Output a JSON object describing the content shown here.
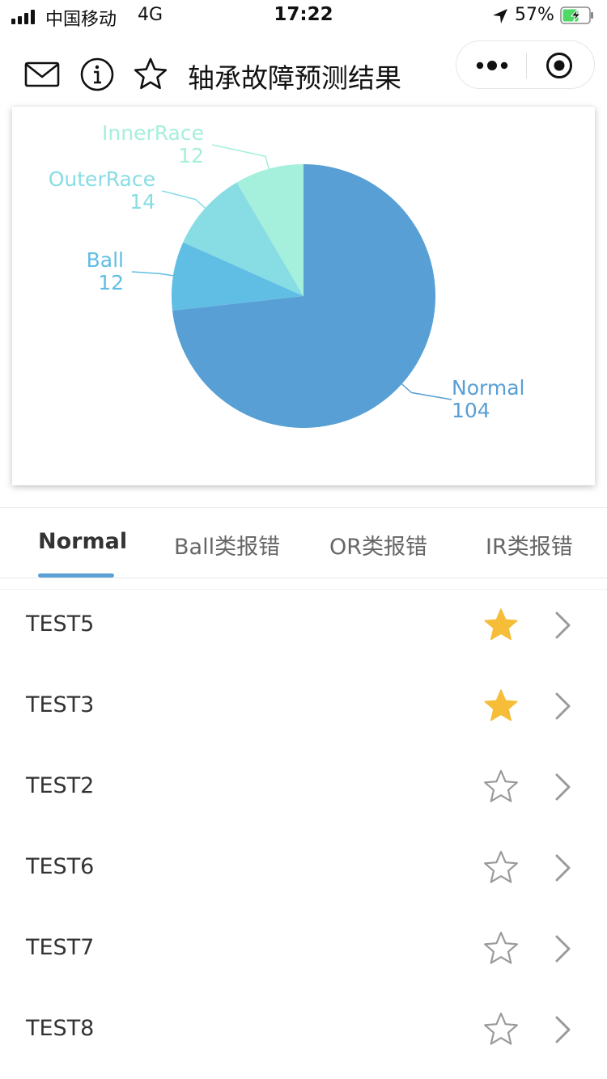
{
  "status_bar": {
    "carrier": "中国移动",
    "network": "4G",
    "time": "17:22",
    "battery": "57%",
    "icons": [
      "signal-icon",
      "location-arrow-icon",
      "battery-charging-icon"
    ]
  },
  "nav": {
    "title": "轴承故障预测结果",
    "icons": [
      "mail-icon",
      "info-icon",
      "star-outline-icon",
      "more-dots-icon",
      "target-icon"
    ]
  },
  "chart_data": {
    "type": "pie",
    "slices": [
      {
        "label": "Normal",
        "value": 104,
        "color": "#579fd5"
      },
      {
        "label": "Ball",
        "value": 12,
        "color": "#60bee4"
      },
      {
        "label": "OuterRace",
        "value": 14,
        "color": "#87dde3"
      },
      {
        "label": "InnerRace",
        "value": 12,
        "color": "#a5efdd"
      }
    ]
  },
  "tabs": [
    {
      "label": "Normal",
      "active": true
    },
    {
      "label": "Ball类报错",
      "active": false
    },
    {
      "label": "OR类报错",
      "active": false
    },
    {
      "label": "IR类报错",
      "active": false
    }
  ],
  "list": [
    {
      "name": "TEST5",
      "starred": true
    },
    {
      "name": "TEST3",
      "starred": true
    },
    {
      "name": "TEST2",
      "starred": false
    },
    {
      "name": "TEST6",
      "starred": false
    },
    {
      "name": "TEST7",
      "starred": false
    },
    {
      "name": "TEST8",
      "starred": false
    }
  ],
  "colors": {
    "accent": "#5aa0d6",
    "star_filled": "#f5bd38",
    "star_outline": "#9a9a9a",
    "chevron": "#9a9a9a"
  }
}
